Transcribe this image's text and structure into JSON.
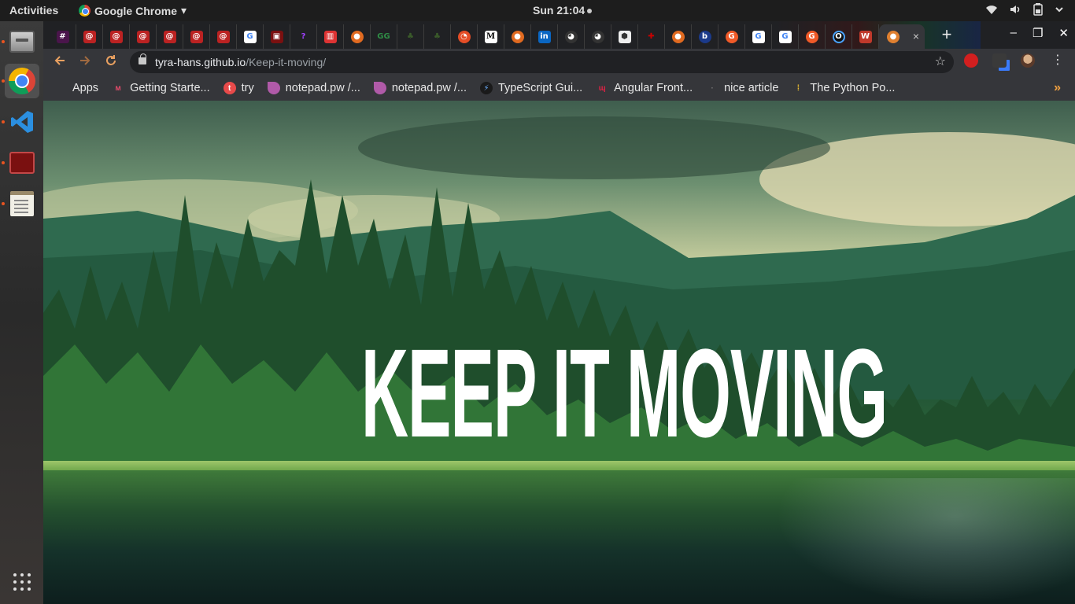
{
  "topbar": {
    "activities": "Activities",
    "app_name": "Google Chrome",
    "app_menu_arrow": "▾",
    "clock": "Sun 21:04"
  },
  "dock": {
    "items": [
      {
        "name": "files",
        "icon": "file-cabinet-icon"
      },
      {
        "name": "chrome",
        "icon": "chrome-icon"
      },
      {
        "name": "vscode",
        "icon": "vscode-icon"
      },
      {
        "name": "terminal",
        "icon": "terminal-icon"
      },
      {
        "name": "text-editor",
        "icon": "text-editor-icon"
      }
    ],
    "show_apps_icon": "app-grid-icon"
  },
  "browser": {
    "tab_close": "×",
    "new_tab": "+",
    "window_controls": {
      "minimize": "‒",
      "maximize": "❐",
      "close": "✕"
    },
    "url_host": "tyra-hans.github.io",
    "url_path": "/Keep-it-moving/",
    "bookmark_star": "☆",
    "menu": "⋮",
    "bookmarks_more": "»",
    "bookmarks": [
      {
        "label": "Apps",
        "icon": "apps-grid-icon",
        "color": "#e8e8e8"
      },
      {
        "label": "Getting Starte...",
        "icon": "nx-logo-icon",
        "color": "#e14a6a"
      },
      {
        "label": "try",
        "icon": "try-logo-icon",
        "color": "#e84a4a"
      },
      {
        "label": "notepad.pw /...",
        "icon": "notepad-icon",
        "color": "#b05aa8"
      },
      {
        "label": "notepad.pw /...",
        "icon": "notepad-icon",
        "color": "#b05aa8"
      },
      {
        "label": "TypeScript Gui...",
        "icon": "typescript-icon",
        "color": "#3a7bd5"
      },
      {
        "label": "Angular Front...",
        "icon": "angular-icon",
        "color": "#dd2244"
      },
      {
        "label": "nice article",
        "icon": "medium-dot-icon",
        "color": "#777777"
      },
      {
        "label": "The Python Po...",
        "icon": "python-icon",
        "color": "#f0c030"
      }
    ]
  },
  "page": {
    "hero_title": "KEEP IT MOVING"
  },
  "colors": {
    "topbar_bg": "#1d1d1d",
    "tabstrip_bg": "#202124",
    "toolbar_bg": "#35363a",
    "accent_orange": "#e95420",
    "hero_text": "#ffffff"
  }
}
